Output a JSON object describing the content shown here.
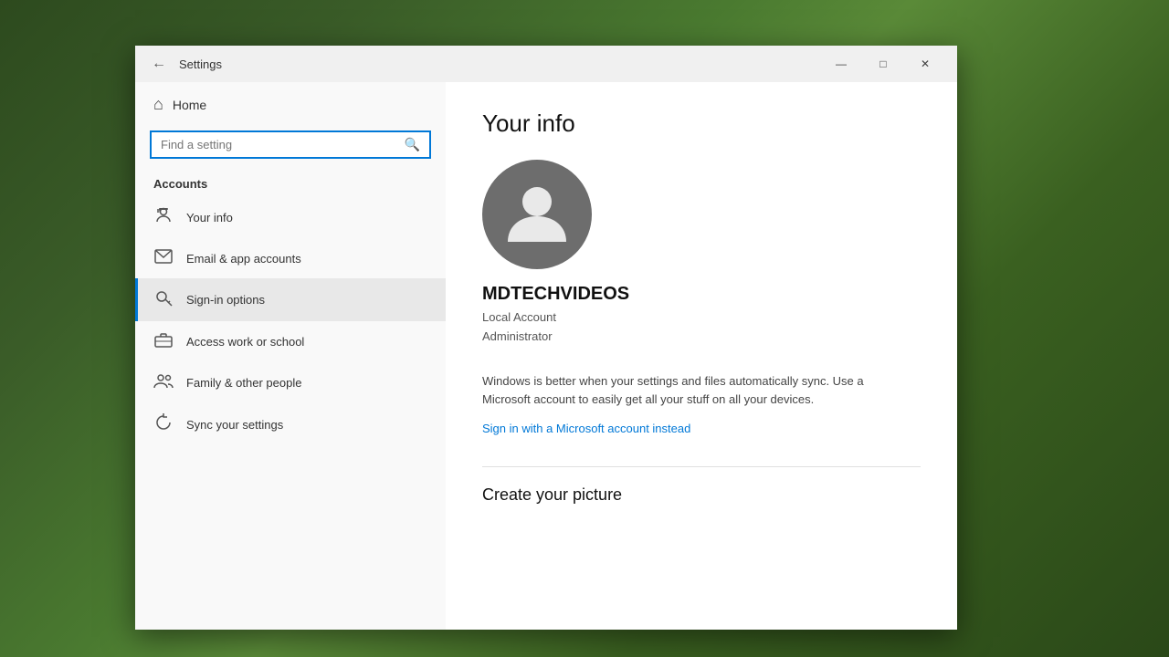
{
  "background": {},
  "window": {
    "title": "Settings",
    "controls": {
      "minimize": "—",
      "maximize": "□",
      "close": "✕"
    }
  },
  "sidebar": {
    "home_label": "Home",
    "search_placeholder": "Find a setting",
    "section_heading": "Accounts",
    "nav_items": [
      {
        "id": "your-info",
        "label": "Your info",
        "icon": "person",
        "active": false
      },
      {
        "id": "email-app-accounts",
        "label": "Email & app accounts",
        "icon": "email",
        "active": false
      },
      {
        "id": "sign-in-options",
        "label": "Sign-in options",
        "icon": "key",
        "active": true
      },
      {
        "id": "access-work-school",
        "label": "Access work or school",
        "icon": "briefcase",
        "active": false
      },
      {
        "id": "family-other-people",
        "label": "Family & other people",
        "icon": "group",
        "active": false
      },
      {
        "id": "sync-settings",
        "label": "Sync your settings",
        "icon": "sync",
        "active": false
      }
    ]
  },
  "main": {
    "page_title": "Your info",
    "user_name": "MDTECHVIDEOS",
    "user_role_line1": "Local Account",
    "user_role_line2": "Administrator",
    "sync_message": "Windows is better when your settings and files automatically sync. Use a Microsoft account to easily get all your stuff on all your devices.",
    "ms_account_link": "Sign in with a Microsoft account instead",
    "create_picture_heading": "Create your picture"
  }
}
